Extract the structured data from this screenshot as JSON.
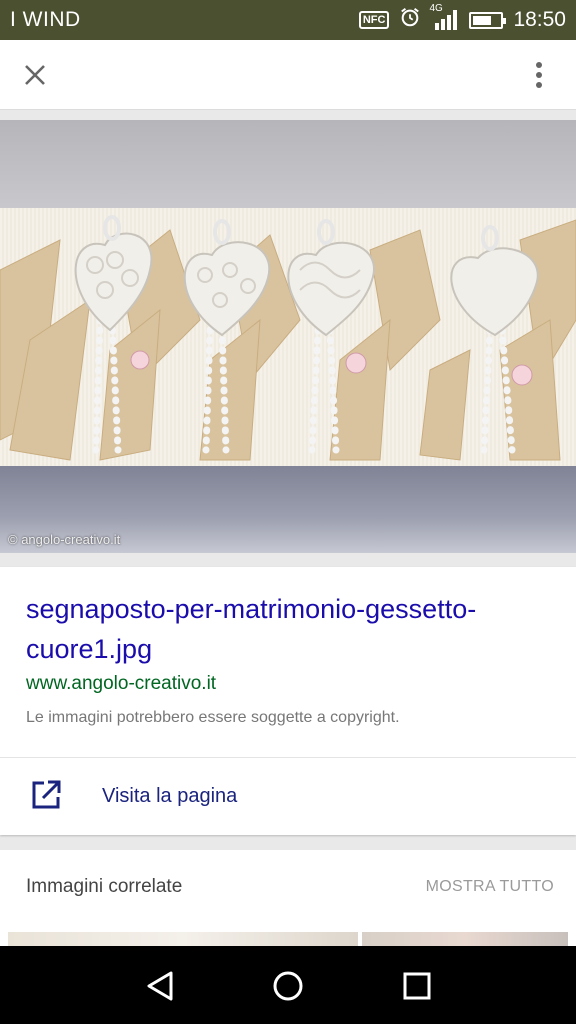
{
  "status_bar": {
    "carrier": "I WIND",
    "nfc_label": "NFC",
    "network_label": "4G",
    "time": "18:50",
    "battery_level": 0.7,
    "icons": [
      "nfc-icon",
      "alarm-icon",
      "signal-icon",
      "battery-icon"
    ]
  },
  "app_bar": {
    "icons": [
      "close-icon",
      "more-vert-icon"
    ]
  },
  "image": {
    "watermark": "© angolo-creativo.it"
  },
  "result": {
    "title": "segnaposto-per-matrimonio-gessetto-cuore1.jpg",
    "site": "www.angolo-creativo.it",
    "copyright_note": "Le immagini potrebbero essere soggette a copyright.",
    "visit_label": "Visita la pagina",
    "visit_icon": "open-in-new-icon",
    "title_color": "#1a0dab",
    "site_color": "#006621"
  },
  "related": {
    "title": "Immagini correlate",
    "show_all": "MOSTRA TUTTO"
  },
  "nav_bar": {
    "icons": [
      "back-icon",
      "home-icon",
      "recents-icon"
    ]
  }
}
